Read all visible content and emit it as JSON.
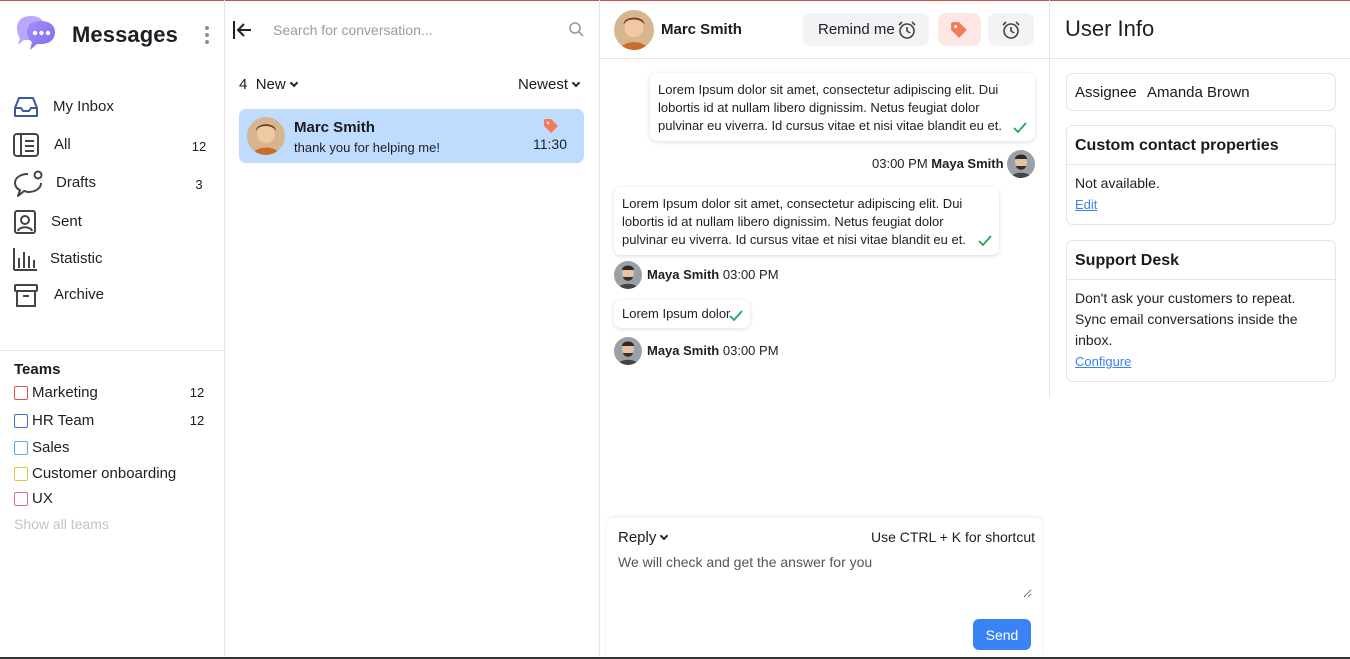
{
  "app": {
    "title": "Messages",
    "accent_color": "#3b82f6",
    "logo_icon": "chat-bubbles-logo"
  },
  "sidebar": {
    "items": [
      {
        "label": "My Inbox",
        "icon": "inbox-icon",
        "count": ""
      },
      {
        "label": "All",
        "icon": "list-icon",
        "count": "12"
      },
      {
        "label": "Drafts",
        "icon": "chat-draft-icon",
        "count": "3"
      },
      {
        "label": "Sent",
        "icon": "user-card-icon",
        "count": ""
      },
      {
        "label": "Statistic",
        "icon": "bar-chart-icon",
        "count": ""
      },
      {
        "label": "Archive",
        "icon": "archive-box-icon",
        "count": ""
      }
    ],
    "teams_heading": "Teams",
    "teams": [
      {
        "label": "Marketing",
        "count": "12",
        "color": "#d9534f"
      },
      {
        "label": "HR Team",
        "count": "12",
        "color": "#3b6fd8"
      },
      {
        "label": "Sales",
        "count": "",
        "color": "#5aa9e6"
      },
      {
        "label": "Customer onboarding",
        "count": "",
        "color": "#e8c341"
      },
      {
        "label": "UX",
        "count": "",
        "color": "#d96aa7"
      }
    ],
    "show_all": "Show all teams"
  },
  "conversations": {
    "search_placeholder": "Search for conversation...",
    "filter_count": "4",
    "filter_label": "New",
    "sort_label": "Newest",
    "items": [
      {
        "name": "Marc Smith",
        "preview": "thank you for helping me!",
        "time": "11:30",
        "tag_color": "#f47a5b"
      }
    ]
  },
  "chat": {
    "contact_name": "Marc Smith",
    "remind_label": "Remind me",
    "messages": [
      {
        "text": "Lorem Ipsum dolor sit amet, consectetur adipiscing elit. Dui lobortis id at nullam libero dignissim. Netus feugiat dolor pulvinar eu viverra. Id cursus vitae et nisi vitae blandit eu et.",
        "time": "03:00 PM",
        "author": "Maya Smith"
      },
      {
        "text": "Lorem Ipsum dolor sit amet, consectetur adipiscing elit. Dui lobortis id at nullam libero dignissim. Netus feugiat dolor pulvinar eu viverra. Id cursus vitae et nisi vitae blandit eu et.",
        "time": "03:00 PM",
        "author": "Maya Smith"
      },
      {
        "text": "Lorem Ipsum dolor",
        "time": "03:00 PM",
        "author": "Maya Smith"
      }
    ],
    "composer": {
      "mode_label": "Reply",
      "shortcut_hint": "Use CTRL + K for shortcut",
      "value": "We will check and get the answer for you",
      "send_label": "Send"
    }
  },
  "user_info": {
    "title": "User Info",
    "assignee_label": "Assignee",
    "assignee_value": "Amanda Brown",
    "custom_props_title": "Custom contact properties",
    "custom_props_body": "Not available.",
    "custom_props_link": "Edit",
    "support_title": "Support Desk",
    "support_body": "Don't ask your customers to repeat. Sync email conversations inside the inbox.",
    "support_link": "Configure"
  }
}
